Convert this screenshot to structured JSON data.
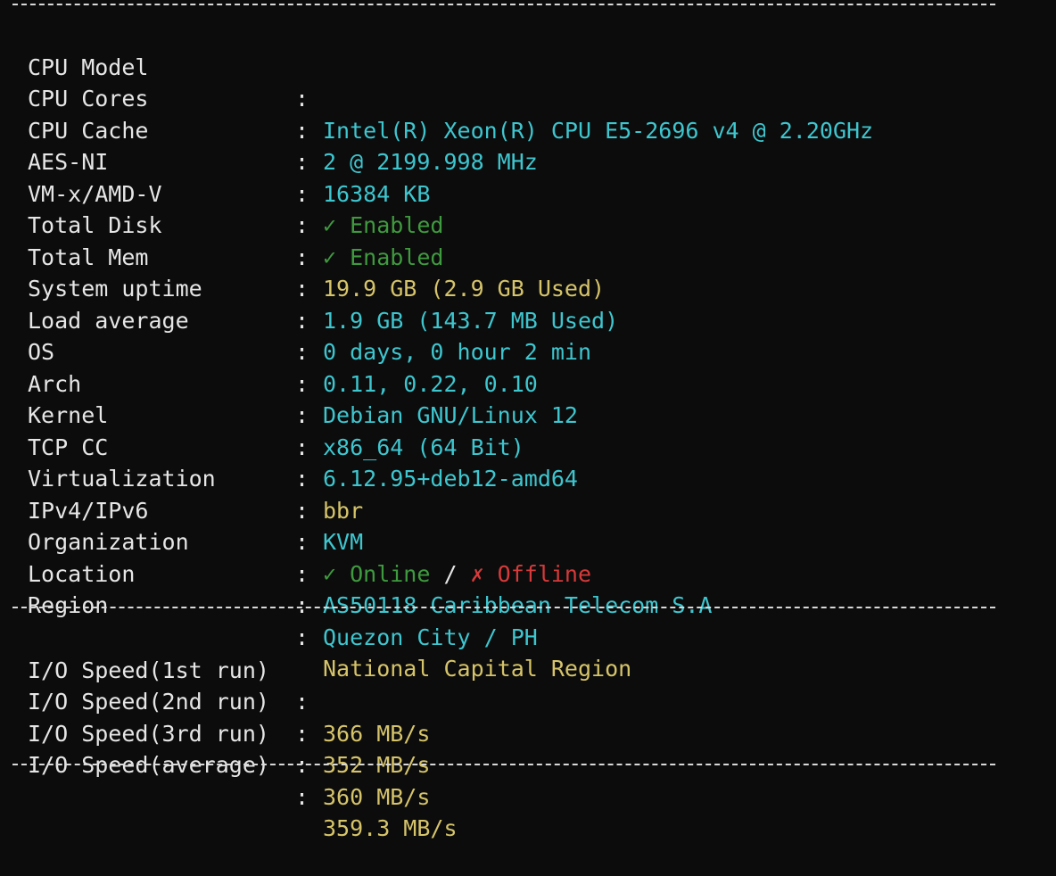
{
  "colors": {
    "background": "#0c0c0c",
    "text": "#e6e6e6",
    "cyan": "#3ec6cf",
    "yellow": "#d6c46a",
    "green": "#3f9a3f",
    "red": "#d63a3a"
  },
  "separator": ":",
  "system_info": [
    {
      "label": "CPU Model",
      "value": "Intel(R) Xeon(R) CPU E5-2696 v4 @ 2.20GHz",
      "color": "cyan"
    },
    {
      "label": "CPU Cores",
      "value": "2 @ 2199.998 MHz",
      "color": "cyan"
    },
    {
      "label": "CPU Cache",
      "value": "16384 KB",
      "color": "cyan"
    },
    {
      "label": "AES-NI",
      "value": "✓ Enabled",
      "color": "green"
    },
    {
      "label": "VM-x/AMD-V",
      "value": "✓ Enabled",
      "color": "green"
    },
    {
      "label": "Total Disk",
      "value": "19.9 GB (2.9 GB Used)",
      "color": "yellow"
    },
    {
      "label": "Total Mem",
      "value": "1.9 GB (143.7 MB Used)",
      "color": "cyan"
    },
    {
      "label": "System uptime",
      "value": "0 days, 0 hour 2 min",
      "color": "cyan"
    },
    {
      "label": "Load average",
      "value": "0.11, 0.22, 0.10",
      "color": "cyan"
    },
    {
      "label": "OS",
      "value": "Debian GNU/Linux 12",
      "color": "cyan"
    },
    {
      "label": "Arch",
      "value": "x86_64 (64 Bit)",
      "color": "cyan"
    },
    {
      "label": "Kernel",
      "value": "6.12.95+deb12-amd64",
      "color": "cyan"
    },
    {
      "label": "TCP CC",
      "value": "bbr",
      "color": "yellow"
    },
    {
      "label": "Virtualization",
      "value": "KVM",
      "color": "cyan"
    }
  ],
  "ip_row": {
    "label": "IPv4/IPv6",
    "ipv4": "✓ Online",
    "slash": " / ",
    "ipv6": "✗ Offline"
  },
  "location_info": [
    {
      "label": "Organization",
      "value": "AS50118 Caribbean Telecom S.A",
      "color": "cyan"
    },
    {
      "label": "Location",
      "value": "Quezon City / PH",
      "color": "cyan"
    },
    {
      "label": "Region",
      "value": "National Capital Region",
      "color": "yellow"
    }
  ],
  "io_info": [
    {
      "label": "I/O Speed(1st run)",
      "value": "366 MB/s"
    },
    {
      "label": "I/O Speed(2nd run)",
      "value": "352 MB/s"
    },
    {
      "label": "I/O Speed(3rd run)",
      "value": "360 MB/s"
    },
    {
      "label": "I/O Speed(average)",
      "value": "359.3 MB/s"
    }
  ]
}
